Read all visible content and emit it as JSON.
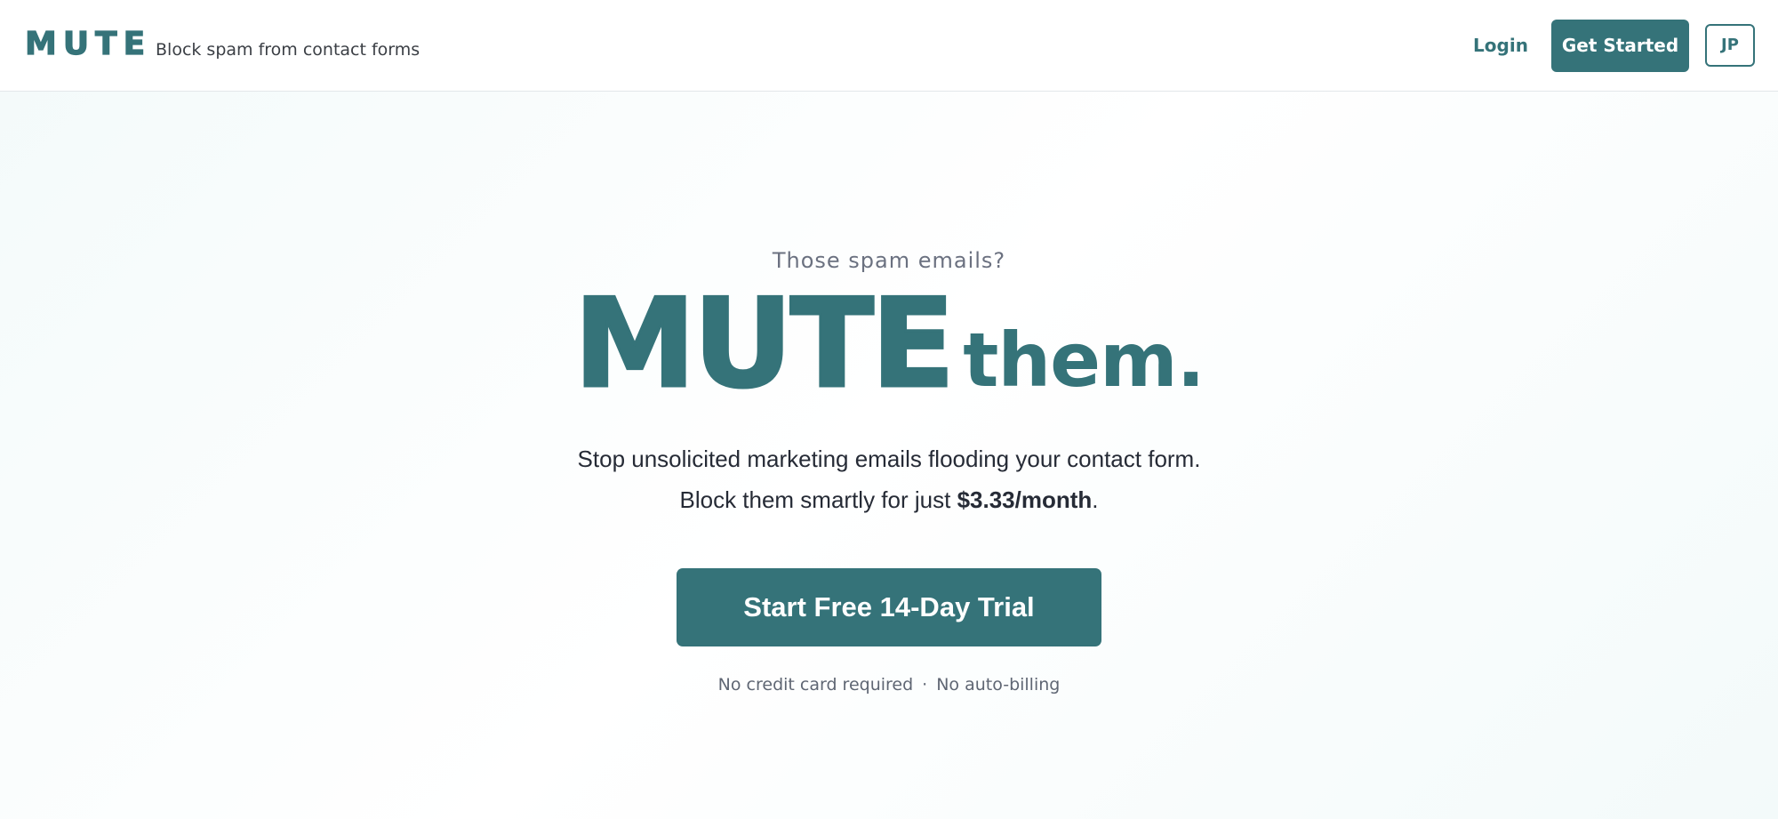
{
  "header": {
    "logo": "MUTE",
    "tagline": "Block spam from contact forms",
    "login_label": "Login",
    "get_started_label": "Get Started",
    "avatar_initials": "JP"
  },
  "hero": {
    "eyebrow": "Those spam emails?",
    "title_big": "MUTE",
    "title_small": "them.",
    "description_line1": "Stop unsolicited marketing emails flooding your contact form.",
    "description_line2_prefix": "Block them smartly for just ",
    "description_line2_price": "$3.33/month",
    "description_line2_suffix": ".",
    "cta_label": "Start Free 14-Day Trial",
    "fine_print_1": "No credit card required",
    "fine_print_separator": "·",
    "fine_print_2": "No auto-billing"
  },
  "colors": {
    "brand": "#357379",
    "text_dark": "#262b36",
    "text_muted": "#6b7180"
  }
}
